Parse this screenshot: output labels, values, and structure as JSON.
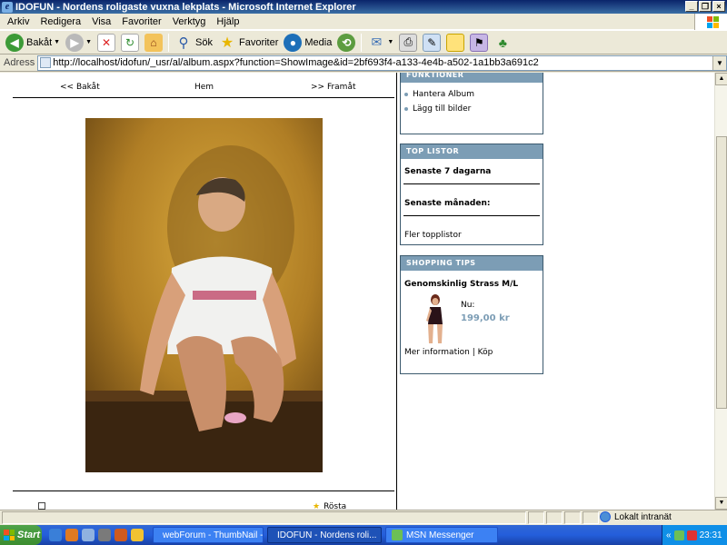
{
  "window": {
    "title": "IDOFUN - Nordens roligaste vuxna lekplats - Microsoft Internet Explorer",
    "buttons": [
      "_",
      "❐",
      "×"
    ]
  },
  "menu": [
    "Arkiv",
    "Redigera",
    "Visa",
    "Favoriter",
    "Verktyg",
    "Hjälp"
  ],
  "toolbar": {
    "back": "Bakåt",
    "search": "Sök",
    "favorites": "Favoriter",
    "media": "Media"
  },
  "address": {
    "label": "Adress",
    "url": "http://localhost/idofun/_usr/al/album.aspx?function=ShowImage&id=2bf693f4-a133-4e4b-a502-1a1bb3a691c2"
  },
  "page": {
    "nav": {
      "prev": "<< Bakåt",
      "home": "Hem",
      "next": ">> Framåt"
    },
    "bottom_right": "Rösta"
  },
  "sidebar": {
    "funktioner": {
      "header": "FUNKTIONER",
      "items": [
        "Hantera Album",
        "Lägg till bilder"
      ]
    },
    "top_listor": {
      "header": "TOP LISTOR",
      "items": [
        "Senaste 7 dagarna",
        "Senaste månaden:"
      ],
      "more": "Fler topplistor"
    },
    "shopping": {
      "header": "SHOPPING TIPS",
      "product": "Genomskinlig Strass M/L",
      "now_label": "Nu:",
      "price": "199,00 kr",
      "more_info": "Mer information",
      "divider": "|",
      "buy": "Köp"
    }
  },
  "statusbar": {
    "zone": "Lokalt intranät"
  },
  "taskbar": {
    "start": "Start",
    "tasks": [
      "webForum - ThumbNail - ...",
      "IDOFUN - Nordens roli...",
      "MSN Messenger"
    ],
    "tray_arrows": "«",
    "clock": "23:31"
  },
  "colors": {
    "box_header": "#7c9db5",
    "price": "#7c9db5",
    "taskbar": "#245edb"
  }
}
